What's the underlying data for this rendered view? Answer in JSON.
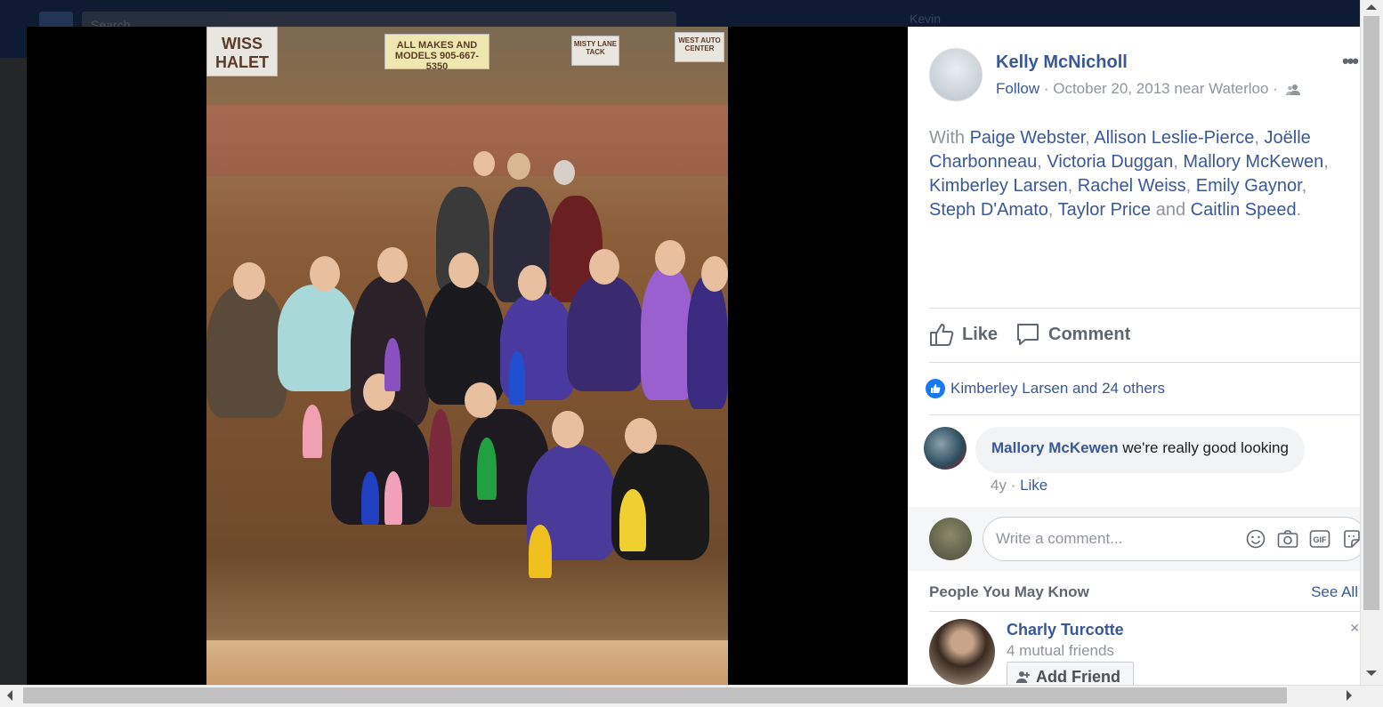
{
  "background": {
    "search_placeholder": "Search",
    "user_name": "Kevin"
  },
  "photo": {
    "banners": [
      "WISS HALET",
      "ALL MAKES AND MODELS 905-667-5350",
      "MISTY LANE TACK",
      "WEST AUTO CENTER"
    ]
  },
  "post": {
    "author": "Kelly McNicholl",
    "follow": "Follow",
    "meta": " · October 20, 2013 near Waterloo · ",
    "more": "•••",
    "with_prefix": "With ",
    "tagged": [
      "Paige Webster",
      "Allison Leslie-Pierce",
      "Joëlle Charbonneau",
      "Victoria Duggan",
      "Mallory McKewen",
      "Kimberley Larsen",
      "Rachel Weiss",
      "Emily Gaynor",
      "Steph D'Amato",
      "Taylor Price"
    ],
    "and_word": " and ",
    "last_tagged": "Caitlin Speed",
    "like_label": "Like",
    "comment_label": "Comment",
    "likes_summary": "Kimberley Larsen and 24 others"
  },
  "comment": {
    "author": "Mallory McKewen",
    "text": "we're really good looking",
    "age": "4y",
    "like": "Like"
  },
  "compose": {
    "placeholder": "Write a comment..."
  },
  "pymk": {
    "title": "People You May Know",
    "see_all": "See All",
    "name": "Charly Turcotte",
    "mutual": "4 mutual friends",
    "add_friend": "Add Friend"
  },
  "colors": {
    "link": "#385898",
    "muted": "#90949c",
    "like_blue": "#1877f2"
  }
}
